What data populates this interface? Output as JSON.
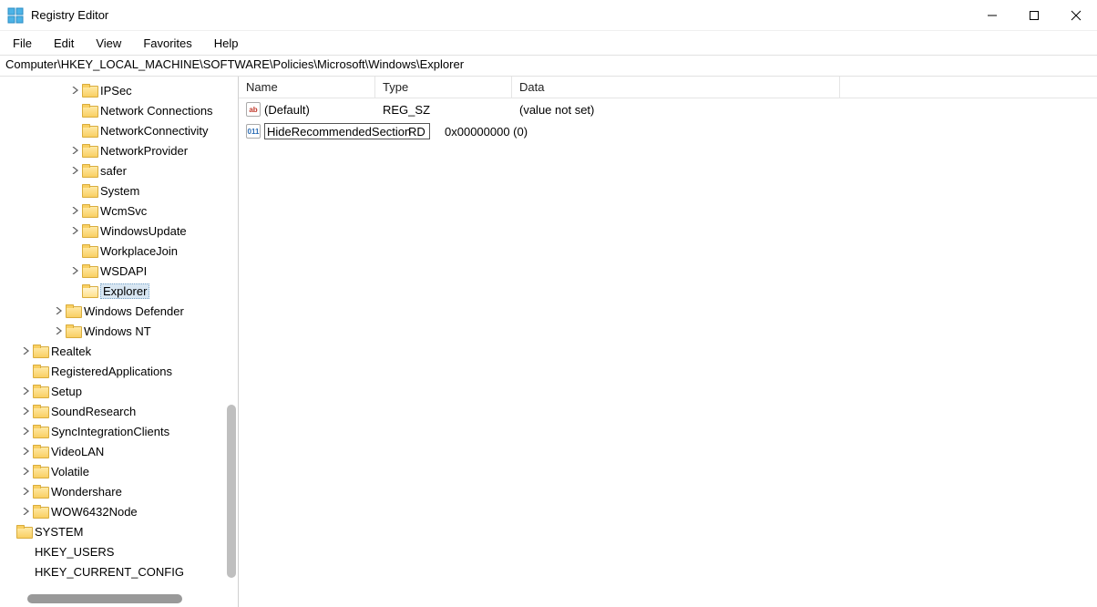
{
  "window": {
    "title": "Registry Editor"
  },
  "menu": {
    "file": "File",
    "edit": "Edit",
    "view": "View",
    "favorites": "Favorites",
    "help": "Help"
  },
  "address": "Computer\\HKEY_LOCAL_MACHINE\\SOFTWARE\\Policies\\Microsoft\\Windows\\Explorer",
  "tree": {
    "items": [
      {
        "indent": 4,
        "chev": ">",
        "icon": true,
        "label": "IPSec"
      },
      {
        "indent": 4,
        "chev": "",
        "icon": true,
        "label": "Network Connections"
      },
      {
        "indent": 4,
        "chev": "",
        "icon": true,
        "label": "NetworkConnectivity"
      },
      {
        "indent": 4,
        "chev": ">",
        "icon": true,
        "label": "NetworkProvider"
      },
      {
        "indent": 4,
        "chev": ">",
        "icon": true,
        "label": "safer"
      },
      {
        "indent": 4,
        "chev": "",
        "icon": true,
        "label": "System"
      },
      {
        "indent": 4,
        "chev": ">",
        "icon": true,
        "label": "WcmSvc"
      },
      {
        "indent": 4,
        "chev": ">",
        "icon": true,
        "label": "WindowsUpdate"
      },
      {
        "indent": 4,
        "chev": "",
        "icon": true,
        "label": "WorkplaceJoin"
      },
      {
        "indent": 4,
        "chev": ">",
        "icon": true,
        "label": "WSDAPI"
      },
      {
        "indent": 4,
        "chev": "",
        "icon": true,
        "label": "Explorer",
        "selected": true,
        "open": true
      },
      {
        "indent": 3,
        "chev": ">",
        "icon": true,
        "label": "Windows Defender"
      },
      {
        "indent": 3,
        "chev": ">",
        "icon": true,
        "label": "Windows NT"
      },
      {
        "indent": 1,
        "chev": ">",
        "icon": true,
        "label": "Realtek"
      },
      {
        "indent": 1,
        "chev": "",
        "icon": true,
        "label": "RegisteredApplications"
      },
      {
        "indent": 1,
        "chev": ">",
        "icon": true,
        "label": "Setup"
      },
      {
        "indent": 1,
        "chev": ">",
        "icon": true,
        "label": "SoundResearch"
      },
      {
        "indent": 1,
        "chev": ">",
        "icon": true,
        "label": "SyncIntegrationClients"
      },
      {
        "indent": 1,
        "chev": ">",
        "icon": true,
        "label": "VideoLAN"
      },
      {
        "indent": 1,
        "chev": ">",
        "icon": true,
        "label": "Volatile"
      },
      {
        "indent": 1,
        "chev": ">",
        "icon": true,
        "label": "Wondershare"
      },
      {
        "indent": 1,
        "chev": ">",
        "icon": true,
        "label": "WOW6432Node"
      },
      {
        "indent": 0,
        "chev": "",
        "icon": true,
        "label": "SYSTEM"
      },
      {
        "indent": 0,
        "chev": "",
        "icon": false,
        "label": "HKEY_USERS"
      },
      {
        "indent": 0,
        "chev": "",
        "icon": false,
        "label": "HKEY_CURRENT_CONFIG"
      }
    ]
  },
  "columns": {
    "name": "Name",
    "type": "Type",
    "data": "Data"
  },
  "values": {
    "row0": {
      "icon_text": "ab",
      "name": "(Default)",
      "type": "REG_SZ",
      "data": "(value not set)"
    },
    "row1": {
      "icon_text": "011",
      "edit_value": "HideRecommendedSection",
      "type_fragment": "RD",
      "data": "0x00000000 (0)"
    }
  }
}
